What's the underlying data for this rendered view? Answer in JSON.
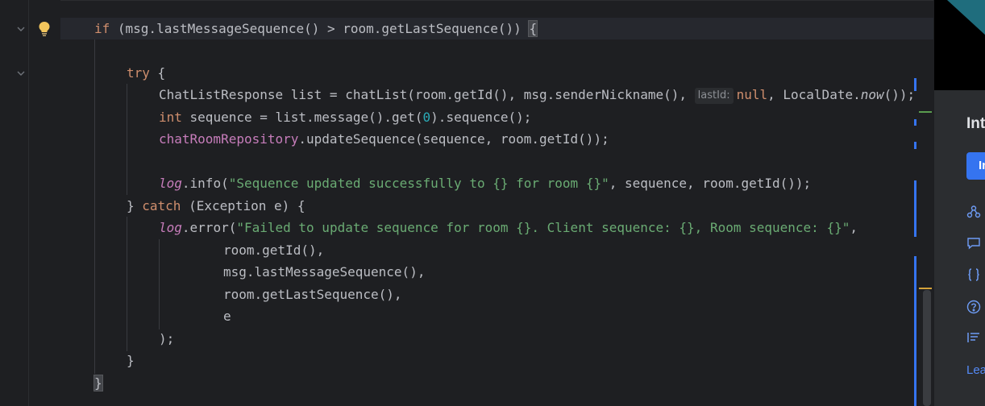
{
  "editor": {
    "lines": [
      {
        "id": "if",
        "parts": [
          "if",
          " (msg.lastMessageSequence() > room.getLastSequence()) ",
          "{"
        ]
      },
      {
        "id": "try",
        "parts": [
          "try",
          " {"
        ]
      },
      {
        "id": "chatlist",
        "parts": [
          "ChatListResponse list = chatList(room.getId(), msg.senderNickname(), ",
          "lastId:",
          "null",
          ", LocalDate.",
          "now",
          "());"
        ]
      },
      {
        "id": "seq",
        "parts": [
          "int",
          " sequence = list.message().get(",
          "0",
          ").sequence();"
        ]
      },
      {
        "id": "repo",
        "parts": [
          "chatRoomRepository",
          ".updateSequence(sequence, room.getId());"
        ]
      },
      {
        "id": "loginfo",
        "parts": [
          "log",
          ".info(",
          "\"Sequence updated successfully to {} for room {}\"",
          ", sequence, room.getId());"
        ]
      },
      {
        "id": "catch",
        "parts": [
          "} ",
          "catch",
          " (Exception e) {"
        ]
      },
      {
        "id": "logerror",
        "parts": [
          "log",
          ".error(",
          "\"Failed to update sequence for room {}. Client sequence: {}, Room sequence: {}\"",
          ","
        ]
      },
      {
        "id": "arg1",
        "parts": [
          "room.getId(),"
        ]
      },
      {
        "id": "arg2",
        "parts": [
          "msg.lastMessageSequence(),"
        ]
      },
      {
        "id": "arg3",
        "parts": [
          "room.getLastSequence(),"
        ]
      },
      {
        "id": "arg4",
        "parts": [
          "e"
        ]
      },
      {
        "id": "closeparen",
        "parts": [
          ");"
        ]
      },
      {
        "id": "closetry",
        "parts": [
          "}"
        ]
      },
      {
        "id": "closeif",
        "parts": [
          "}"
        ]
      }
    ]
  },
  "panel": {
    "title": "Int",
    "button_label": "In",
    "link_label": "Lea",
    "icons": [
      "share-nodes-icon",
      "chat-icon",
      "braces-icon",
      "help-icon",
      "list-icon"
    ]
  },
  "colors": {
    "background": "#1e1f22",
    "keyword": "#cf8e6d",
    "string": "#6aab73",
    "number": "#2aacb8",
    "field": "#c77dbb",
    "text": "#bcbec4",
    "accent": "#3574f0"
  }
}
